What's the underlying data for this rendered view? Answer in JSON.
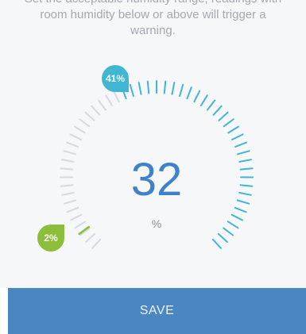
{
  "instruction": {
    "line0": "Set the acceptable humidity range; readings with",
    "line1": "room humidity below or above will trigger a",
    "line2": "warning."
  },
  "gauge": {
    "current_value": "32",
    "unit": "%",
    "high_threshold_label": "41%",
    "low_threshold_label": "2%",
    "high_threshold": 41,
    "low_threshold": 2,
    "colors": {
      "inactive_tick": "#d6d9dd",
      "active_tick": "#41b6d2",
      "low_tick": "#8cbe3c",
      "value_text": "#3f82c8",
      "high_pin": "#41b6d2",
      "low_pin": "#8cbe3c"
    }
  },
  "footer": {
    "save_label": "SAVE",
    "color": "#4a86c2"
  }
}
